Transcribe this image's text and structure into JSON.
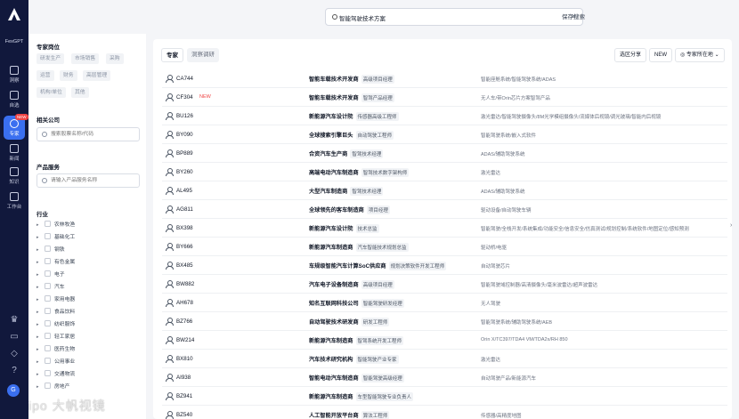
{
  "rail": {
    "brand": "FexGPT",
    "nav": [
      {
        "label": "洞察",
        "icon": "insight-icon"
      },
      {
        "label": "自选",
        "icon": "favorites-icon"
      },
      {
        "label": "专家",
        "icon": "expert-icon",
        "badge": "NEW"
      },
      {
        "label": "新闻",
        "icon": "news-icon"
      },
      {
        "label": "知识",
        "icon": "knowledge-icon"
      },
      {
        "label": "工作台",
        "icon": "workbench-icon"
      }
    ],
    "avatar": "G"
  },
  "topbar": {
    "search_value": "智能驾驶技术方案",
    "save_search": "保存搜索"
  },
  "filters": {
    "role_title": "专家岗位",
    "roles": [
      "研发生产",
      "市场销售",
      "采购",
      "运营",
      "财务",
      "高层管理",
      "机构/单位",
      "其他"
    ],
    "company_title": "相关公司",
    "company_placeholder": "搜索股票名称/代码",
    "product_title": "产品服务",
    "product_placeholder": "请输入产品服务名称",
    "industry_title": "行业",
    "industries": [
      "农林牧渔",
      "基础化工",
      "钢铁",
      "有色金属",
      "电子",
      "汽车",
      "家用电器",
      "食品饮料",
      "纺织服饰",
      "轻工家居",
      "医药生物",
      "公用事业",
      "交通物流",
      "房地产"
    ]
  },
  "results": {
    "tabs": [
      "专家",
      "洞察调研"
    ],
    "actions": {
      "share": "选区分享",
      "new": "NEW",
      "location": "专家所在地"
    },
    "rows": [
      {
        "code": "CA744",
        "new": "",
        "company": "智能车载技术开发商",
        "position": "高级项目经理",
        "tags": "智能座舱系统/智能驾驶系统/ADAS"
      },
      {
        "code": "CF304",
        "new": "NEW",
        "company": "智能车载技术开发商",
        "position": "智驾产品经理",
        "tags": "无人车/带Orin芯片方案智驾产品"
      },
      {
        "code": "BU126",
        "new": "",
        "company": "新能源汽车设计院",
        "position": "传感器高级工程师",
        "tags": "激光雷达/智能驾驶摄像头/8M光学模组摄像头/流媒体后视镜/调光玻璃/智能内后视镜"
      },
      {
        "code": "BY090",
        "new": "",
        "company": "全球搜索引擎巨头",
        "position": "自动驾驶工程师",
        "tags": "智能驾驶系统/嵌入式软件"
      },
      {
        "code": "BP889",
        "new": "",
        "company": "合资汽车生产商",
        "position": "智驾技术经理",
        "tags": "ADAS/辅助驾驶系统"
      },
      {
        "code": "BY260",
        "new": "",
        "company": "高端电动汽车制造商",
        "position": "智驾技术数字架构师",
        "tags": "激光雷达"
      },
      {
        "code": "AL495",
        "new": "",
        "company": "大型汽车制造商",
        "position": "智驾技术经理",
        "tags": "ADAS/辅助驾驶系统"
      },
      {
        "code": "AG811",
        "new": "",
        "company": "全球领先的客车制造商",
        "position": "项目经理",
        "tags": "驱动设备/自动驾驶车辆"
      },
      {
        "code": "BX398",
        "new": "",
        "company": "新能源汽车设计院",
        "position": "技术总监",
        "tags": "智能驾驶/全栈开发/系统集成/功能安全/信息安全/仿真测试/规划控制/系统软件/地图定位/感知预测"
      },
      {
        "code": "BY666",
        "new": "",
        "company": "新能源汽车制造商",
        "position": "汽车智能技术规划总监",
        "tags": "驱动桥/电驱"
      },
      {
        "code": "BX485",
        "new": "",
        "company": "车规级智能汽车计算SoC供应商",
        "position": "规划决策软件开发工程师",
        "tags": "自动驾驶芯片"
      },
      {
        "code": "BW882",
        "new": "",
        "company": "汽车电子设备制造商",
        "position": "高级项目经理",
        "tags": "智能驾驶域控制器/高清摄像头/毫米波雷达/超声波雷达"
      },
      {
        "code": "AH678",
        "new": "",
        "company": "知名互联网科技公司",
        "position": "智能驾驶研发经理",
        "tags": "无人驾驶"
      },
      {
        "code": "BZ766",
        "new": "",
        "company": "自动驾驶技术研发商",
        "position": "研发工程师",
        "tags": "智能驾驶系统/辅助驾驶系统/AEB"
      },
      {
        "code": "BW214",
        "new": "",
        "company": "新能源汽车制造商",
        "position": "智驾系统开发工程师",
        "tags": "Orin X/TC397/TDA4 VM/TDA2x/RH 850"
      },
      {
        "code": "BX810",
        "new": "",
        "company": "汽车技术研究机构",
        "position": "智能驾驶产业专家",
        "tags": "激光雷达"
      },
      {
        "code": "AI938",
        "new": "",
        "company": "智能电动汽车制造商",
        "position": "智能驾驶高级经理",
        "tags": "自动驾驶产品/新能源汽车"
      },
      {
        "code": "BZ941",
        "new": "",
        "company": "新能源汽车制造商",
        "position": "车型智能驾驶专业负责人",
        "tags": ""
      },
      {
        "code": "BZ540",
        "new": "",
        "company": "人工智能开放平台商",
        "position": "算法工程师",
        "tags": "传感器/高精度地图"
      }
    ]
  },
  "watermark": "ipo 大帆视镜"
}
